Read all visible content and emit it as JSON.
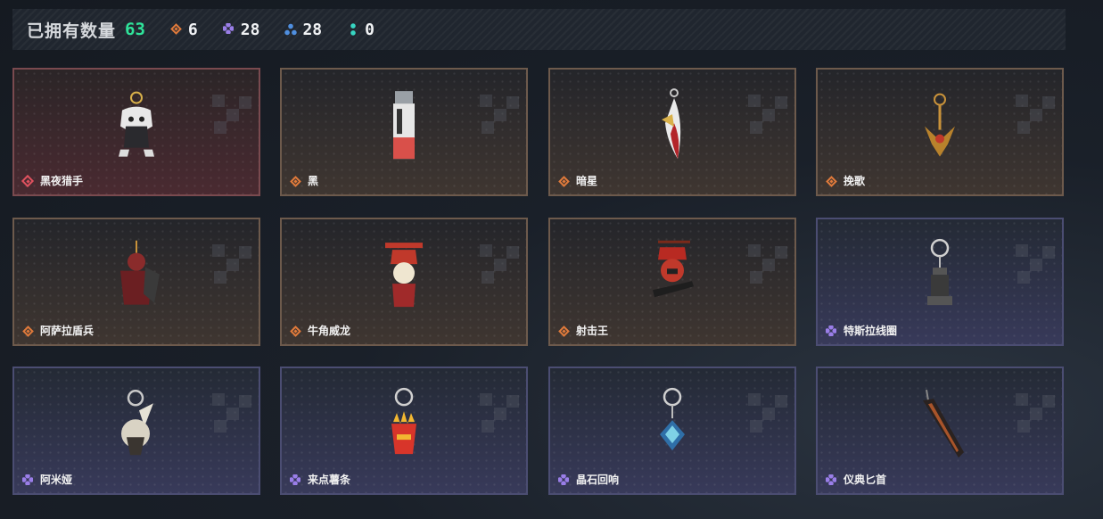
{
  "header": {
    "owned_label": "已拥有数量",
    "owned_count": "63",
    "stats": [
      {
        "icon": "orange-gem-icon",
        "color": "#e07a3b",
        "value": "6"
      },
      {
        "icon": "purple-gem-icon",
        "color": "#9a7ee8",
        "value": "28"
      },
      {
        "icon": "blue-gem-icon",
        "color": "#4f8fe0",
        "value": "28"
      },
      {
        "icon": "teal-gem-icon",
        "color": "#37d6c2",
        "value": "0"
      }
    ]
  },
  "items": [
    {
      "name": "黑夜猎手",
      "rarity": "red"
    },
    {
      "name": "黑",
      "rarity": "orange"
    },
    {
      "name": "暗星",
      "rarity": "orange"
    },
    {
      "name": "挽歌",
      "rarity": "orange"
    },
    {
      "name": "阿萨拉盾兵",
      "rarity": "orange"
    },
    {
      "name": "牛角威龙",
      "rarity": "orange"
    },
    {
      "name": "射击王",
      "rarity": "orange"
    },
    {
      "name": "特斯拉线圈",
      "rarity": "purple"
    },
    {
      "name": "阿米娅",
      "rarity": "purple"
    },
    {
      "name": "来点薯条",
      "rarity": "purple"
    },
    {
      "name": "晶石回响",
      "rarity": "purple"
    },
    {
      "name": "仪典匕首",
      "rarity": "purple"
    }
  ]
}
